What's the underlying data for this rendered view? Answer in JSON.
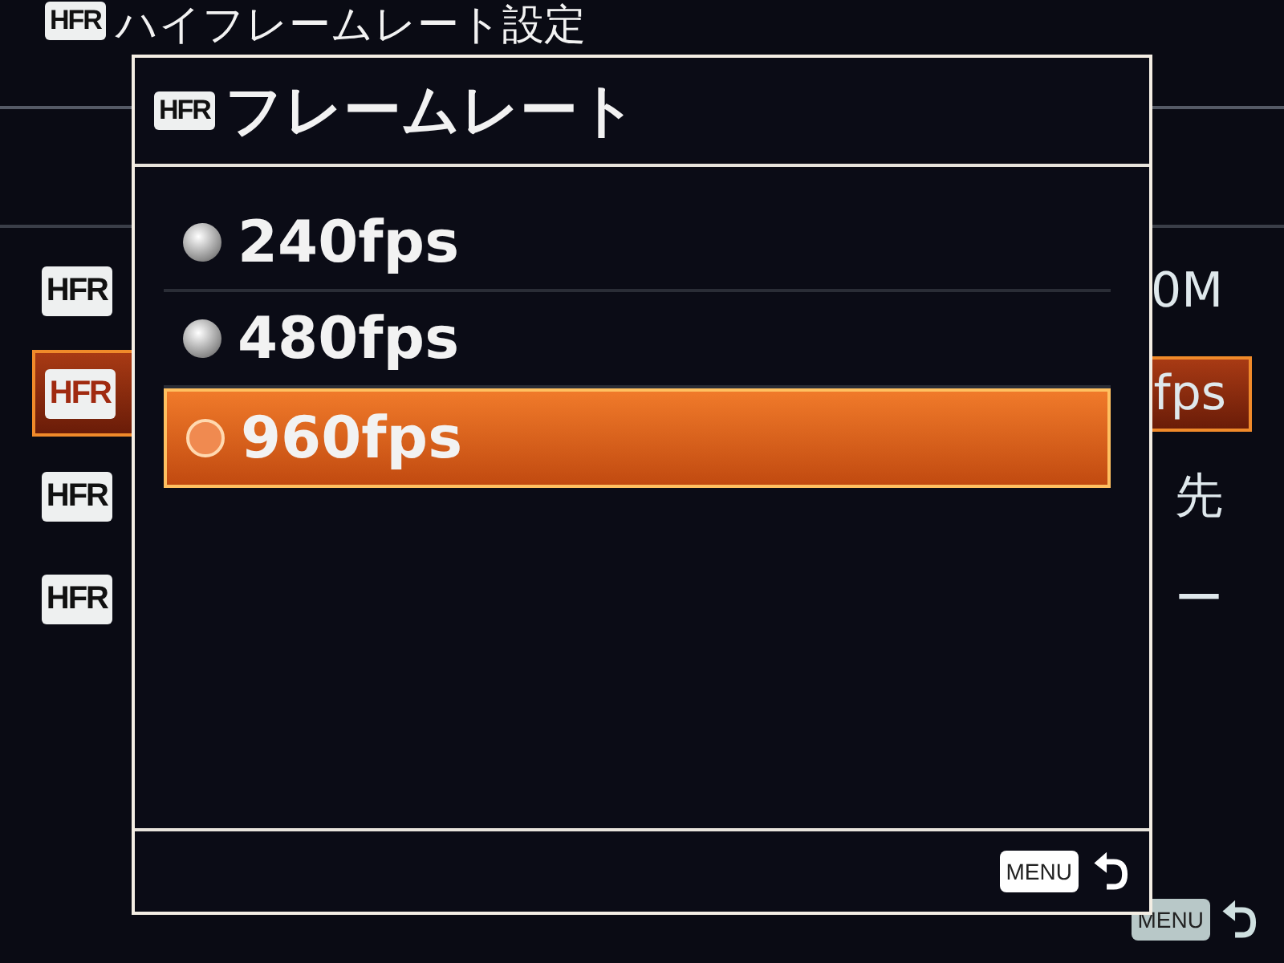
{
  "background": {
    "title_icon": "HFR",
    "title": "ハイフレームレート設定",
    "rows": [
      {
        "icon": "HFR",
        "value": "0M",
        "selected": false
      },
      {
        "icon": "HFR",
        "value": "fps",
        "selected": true
      },
      {
        "icon": "HFR",
        "value": "先",
        "selected": false
      },
      {
        "icon": "HFR",
        "value": "ー",
        "selected": false
      }
    ],
    "footer_key": "MENU"
  },
  "dialog": {
    "title_icon": "HFR",
    "title": "フレームレート",
    "options": [
      {
        "label": "240fps",
        "selected": false
      },
      {
        "label": "480fps",
        "selected": false
      },
      {
        "label": "960fps",
        "selected": true
      }
    ],
    "footer_key": "MENU"
  }
}
